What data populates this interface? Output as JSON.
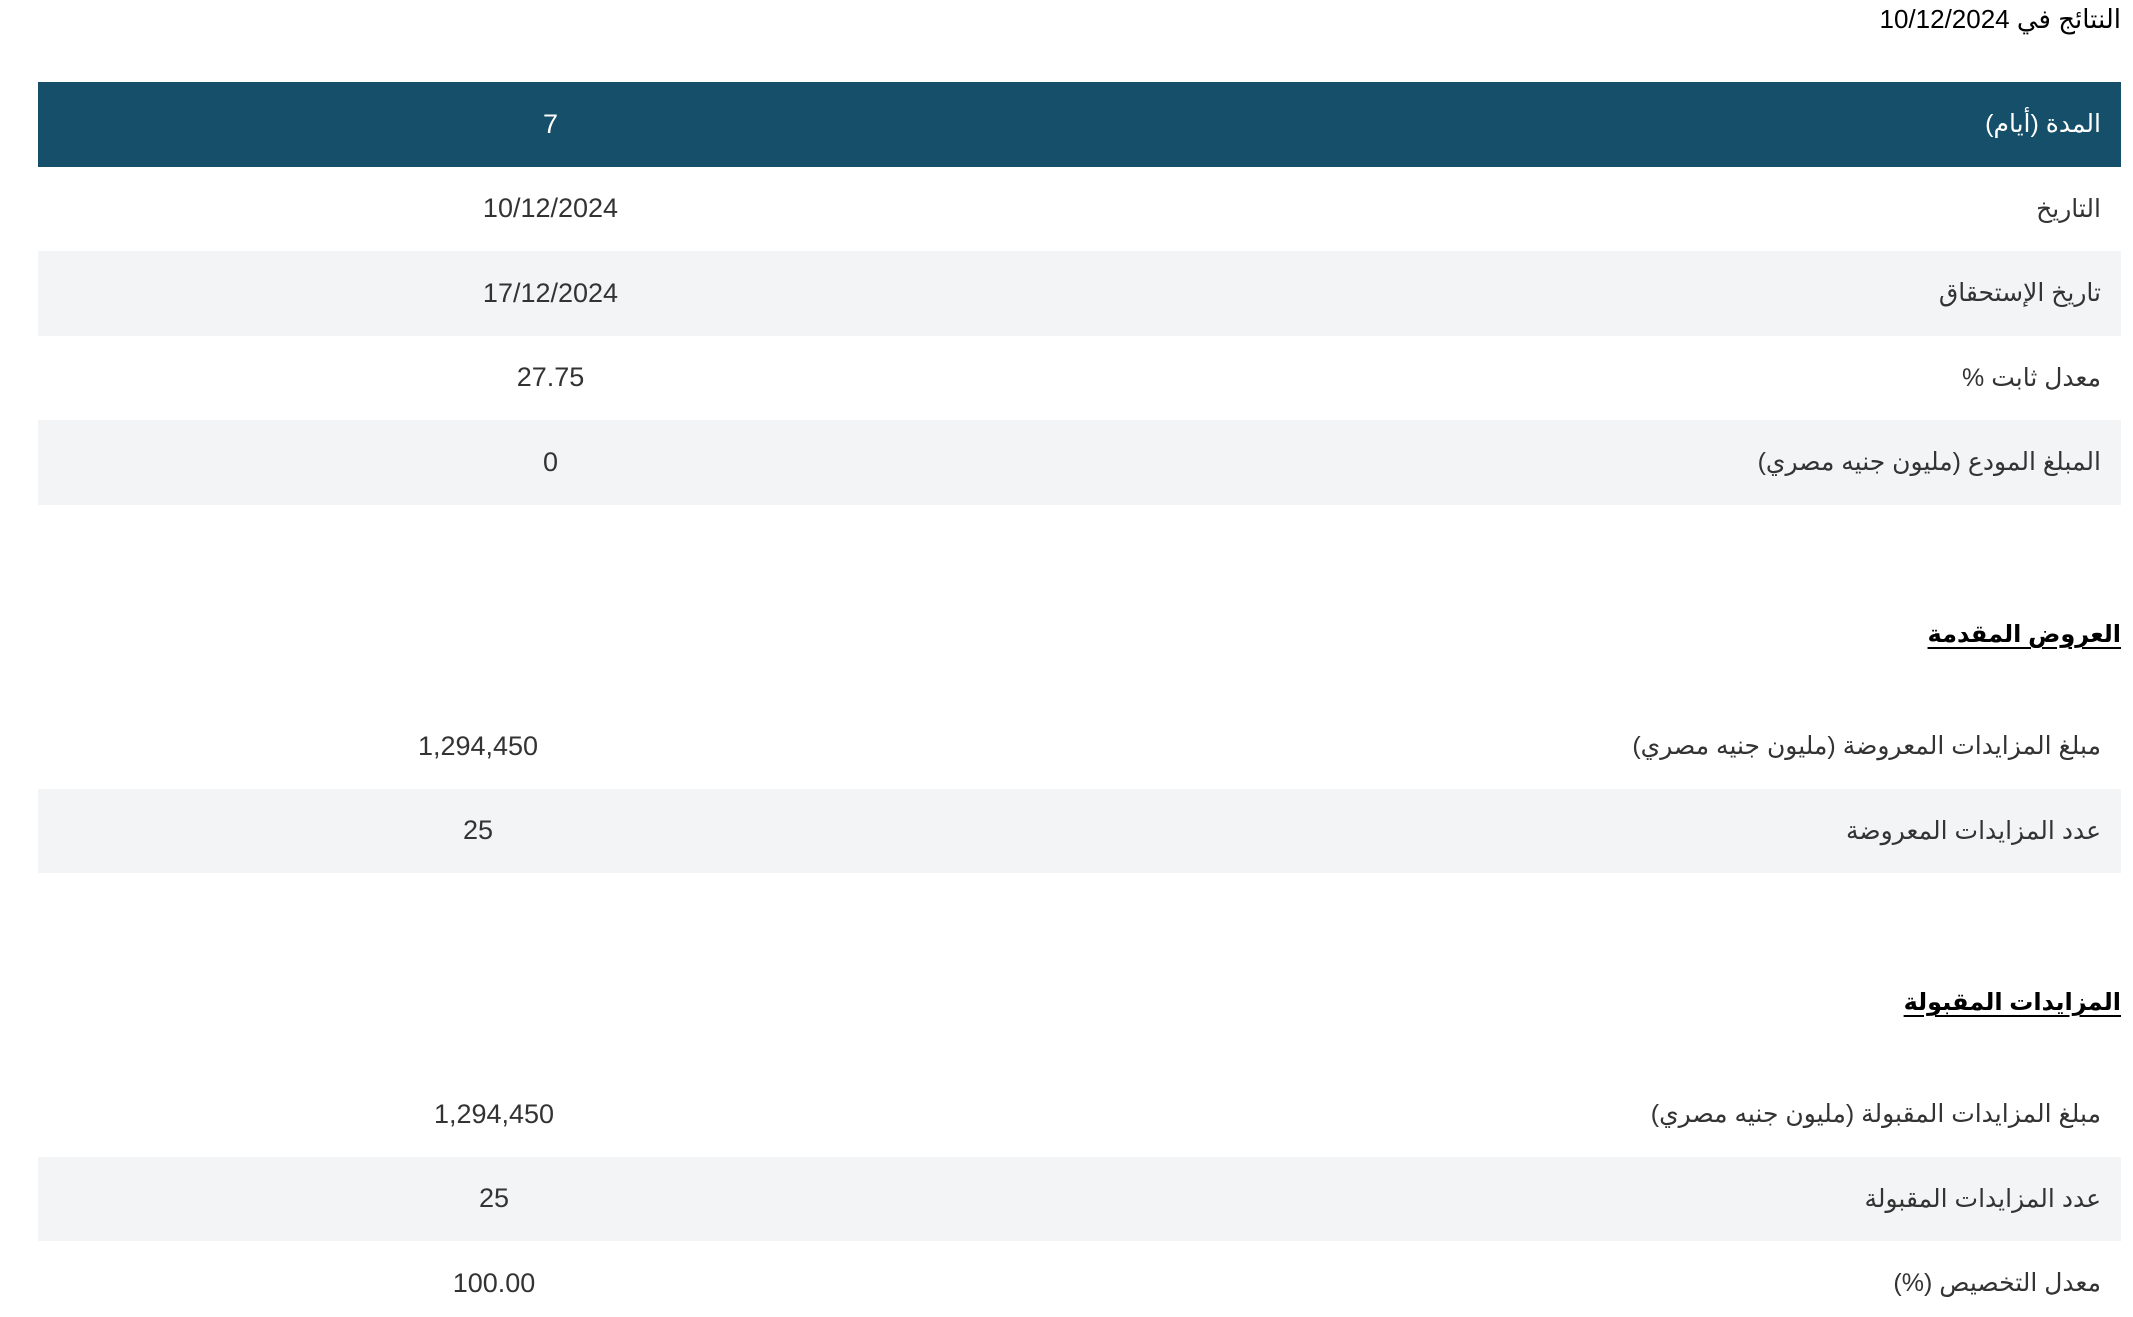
{
  "results_heading": {
    "prefix": "النتائج في",
    "date": "10/12/2024"
  },
  "main_table": {
    "rows": [
      {
        "label": "المدة (أيام)",
        "value": "7"
      },
      {
        "label": "التاريخ",
        "value": "10/12/2024"
      },
      {
        "label": "تاريخ الإستحقاق",
        "value": "17/12/2024"
      },
      {
        "label": "معدل ثابت %",
        "value": "27.75"
      },
      {
        "label": "المبلغ المودع (مليون جنيه مصري)",
        "value": "0"
      }
    ]
  },
  "offers_section": {
    "title": "العروض المقدمة",
    "rows": [
      {
        "label": "مبلغ المزايدات المعروضة (مليون جنيه مصري)",
        "value": "1,294,450"
      },
      {
        "label": "عدد المزايدات المعروضة",
        "value": "25"
      }
    ]
  },
  "accepted_section": {
    "title": "المزايدات المقبولة",
    "rows": [
      {
        "label": "مبلغ المزايدات المقبولة (مليون جنيه مصري)",
        "value": "1,294,450"
      },
      {
        "label": "عدد المزايدات المقبولة",
        "value": "25"
      },
      {
        "label": "معدل التخصيص (%)",
        "value": "100.00"
      }
    ]
  },
  "colors": {
    "header_background": "#164f6a",
    "header_text": "#ffffff",
    "shaded_row": "#f3f4f5"
  }
}
